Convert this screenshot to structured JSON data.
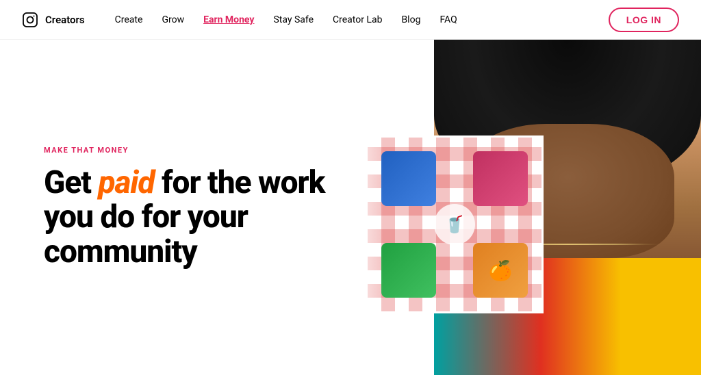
{
  "header": {
    "logo_text": "Creators",
    "login_label": "LOG IN",
    "nav_items": [
      {
        "label": "Create",
        "href": "#",
        "active": false
      },
      {
        "label": "Grow",
        "href": "#",
        "active": false
      },
      {
        "label": "Earn Money",
        "href": "#",
        "active": true
      },
      {
        "label": "Stay Safe",
        "href": "#",
        "active": false
      },
      {
        "label": "Creator Lab",
        "href": "#",
        "active": false
      },
      {
        "label": "Blog",
        "href": "#",
        "active": false
      },
      {
        "label": "FAQ",
        "href": "#",
        "active": false
      }
    ]
  },
  "hero": {
    "eyebrow": "MAKE THAT MONEY",
    "headline_part1": "Get ",
    "headline_highlight": "paid",
    "headline_part2": " for the work you do for your community",
    "colors": {
      "eyebrow": "#e0245e",
      "highlight": "#ff6600",
      "accent": "#e0245e"
    }
  }
}
